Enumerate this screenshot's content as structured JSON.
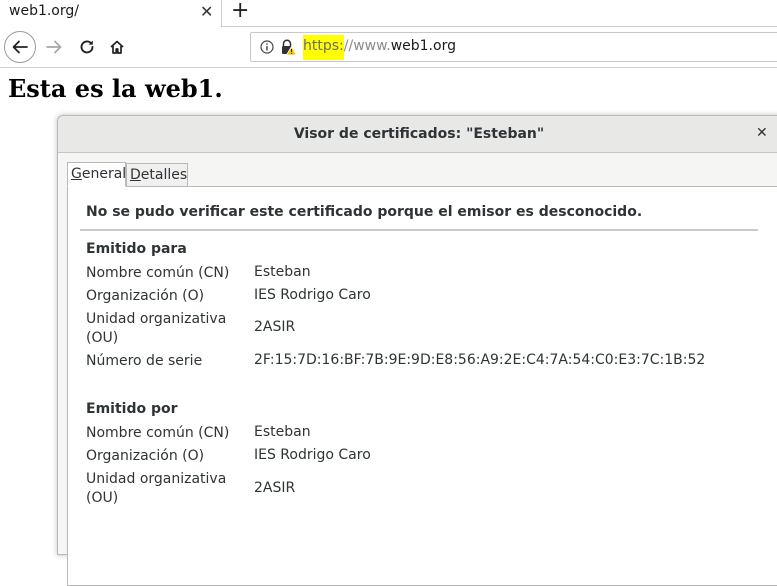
{
  "browser": {
    "tab": {
      "title": "web1.org/",
      "close_glyph": "✕"
    },
    "new_tab_glyph": "+",
    "url": {
      "scheme": "https:",
      "slashes": "//",
      "www": "www.",
      "host": "web1.org"
    },
    "icons": [
      "back-arrow-icon",
      "forward-arrow-icon",
      "reload-icon",
      "home-icon",
      "info-icon",
      "warning-lock-icon"
    ],
    "highlight_color": "#ffff00"
  },
  "page": {
    "heading": "Esta es la web1."
  },
  "dialog": {
    "title": "Visor de certificados: \"Esteban\"",
    "close_glyph": "✕",
    "tabs": [
      {
        "mnemonic": "G",
        "rest": "eneral",
        "selected": true
      },
      {
        "mnemonic": "D",
        "rest": "etalles",
        "selected": false
      }
    ],
    "warning": "No se pudo verificar este certificado porque el emisor es desconocido.",
    "issued_to": {
      "title": "Emitido para",
      "rows": [
        {
          "label": "Nombre común (CN)",
          "value": "Esteban"
        },
        {
          "label": "Organización (O)",
          "value": "IES Rodrigo Caro"
        },
        {
          "label": "Unidad organizativa (OU)",
          "value": "2ASIR"
        },
        {
          "label": "Número de serie",
          "value": "2F:15:7D:16:BF:7B:9E:9D:E8:56:A9:2E:C4:7A:54:C0:E3:7C:1B:52"
        }
      ]
    },
    "issued_by": {
      "title": "Emitido por",
      "rows": [
        {
          "label": "Nombre común (CN)",
          "value": "Esteban"
        },
        {
          "label": "Organización (O)",
          "value": "IES Rodrigo Caro"
        },
        {
          "label": "Unidad organizativa (OU)",
          "value": "2ASIR"
        }
      ]
    }
  }
}
